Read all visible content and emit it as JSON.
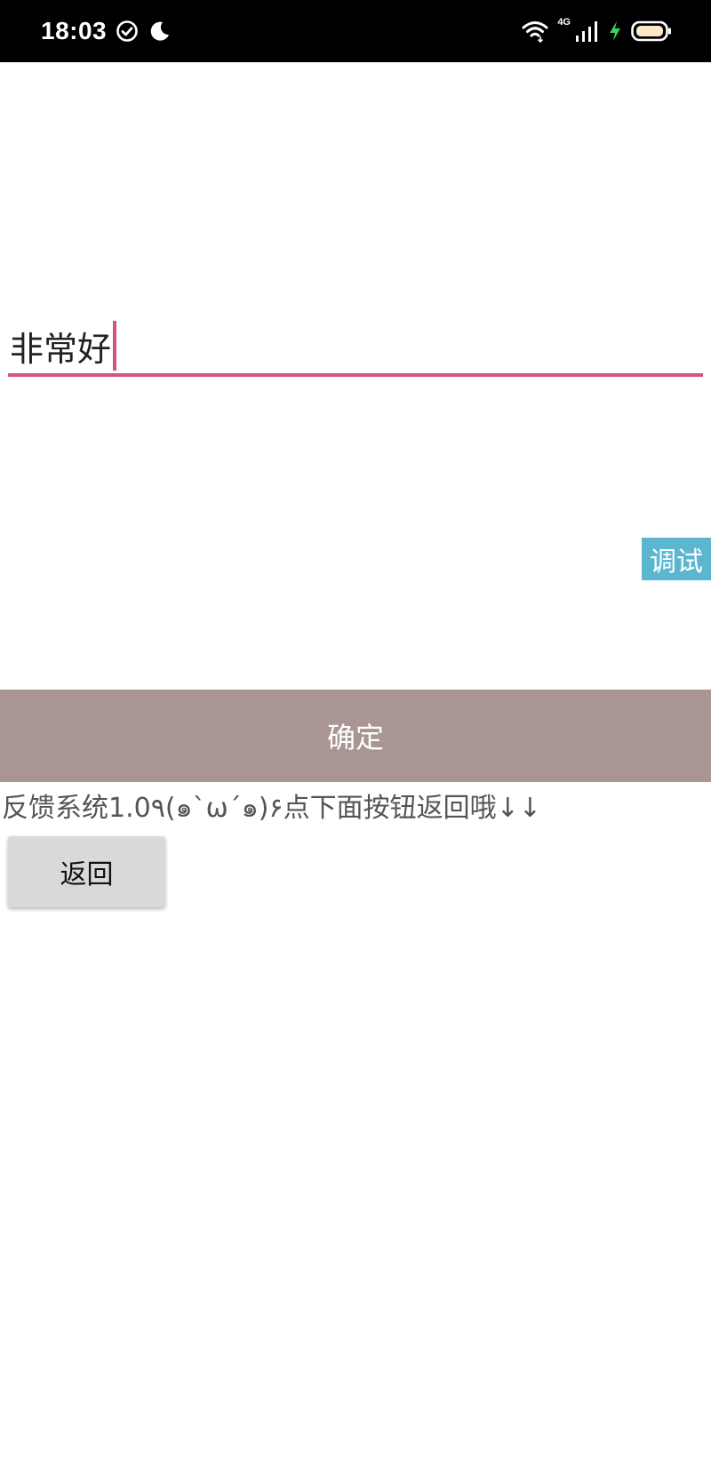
{
  "status_bar": {
    "time": "18:03",
    "network_label": "4G",
    "icons": [
      "check-circle-icon",
      "moon-icon",
      "wifi-icon",
      "signal-icon",
      "charging-icon",
      "battery-icon"
    ]
  },
  "feedback_input": {
    "value": "非常好"
  },
  "debug_tab": {
    "label": "调试"
  },
  "confirm_button": {
    "label": "确定"
  },
  "info_text": "反馈系统1.0٩(๑`ω´๑)۶点下面按钮返回哦↓↓",
  "back_button": {
    "label": "返回"
  },
  "colors": {
    "accent": "#d1557f",
    "confirm_bg": "#a99592",
    "debug_bg": "#5bb7cf",
    "back_bg": "#d8dada"
  }
}
